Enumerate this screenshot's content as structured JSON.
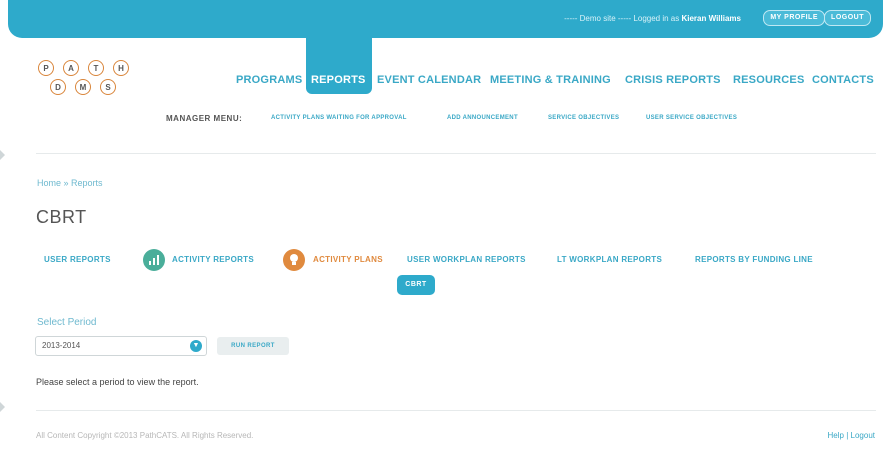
{
  "topbar": {
    "demo_text": "----- Demo site ----- Logged in as",
    "user_name": "Kieran Williams",
    "my_profile_label": "MY PROFILE",
    "logout_label": "LOGOUT"
  },
  "logo": {
    "letters_top": [
      "P",
      "A",
      "T",
      "H"
    ],
    "letters_bottom": [
      "D",
      "M",
      "S"
    ]
  },
  "main_nav": {
    "items": [
      "PROGRAMS",
      "REPORTS",
      "EVENT CALENDAR",
      "MEETING & TRAINING",
      "CRISIS REPORTS",
      "RESOURCES",
      "CONTACTS"
    ],
    "active": "REPORTS"
  },
  "manager_menu": {
    "label": "MANAGER MENU:",
    "items": [
      "ACTIVITY PLANS WAITING FOR APPROVAL",
      "ADD ANNOUNCEMENT",
      "SERVICE OBJECTIVES",
      "USER SERVICE OBJECTIVES"
    ]
  },
  "breadcrumb": "Home » Reports",
  "page_title": "CBRT",
  "sub_nav": {
    "items": [
      "USER REPORTS",
      "ACTIVITY REPORTS",
      "ACTIVITY PLANS",
      "USER WORKPLAN REPORTS",
      "LT WORKPLAN REPORTS",
      "REPORTS BY FUNDING LINE"
    ],
    "active": "CBRT",
    "icons": [
      "chart-icon",
      "lightbulb-icon"
    ],
    "colors": {
      "blue": "#2eaacb",
      "orange": "#e08a3e"
    }
  },
  "period": {
    "label": "Select Period",
    "value": "2013-2014",
    "run_label": "RUN REPORT"
  },
  "info_text": "Please select a period to view the report.",
  "footer": {
    "copyright": "All Content Copyright ©2013 PathCATS. All Rights Reserved.",
    "help": "Help",
    "separator": "|",
    "logout": "Logout"
  },
  "colors": {
    "accent": "#2eaacb",
    "orange": "#e08a3e",
    "text": "#555555"
  }
}
